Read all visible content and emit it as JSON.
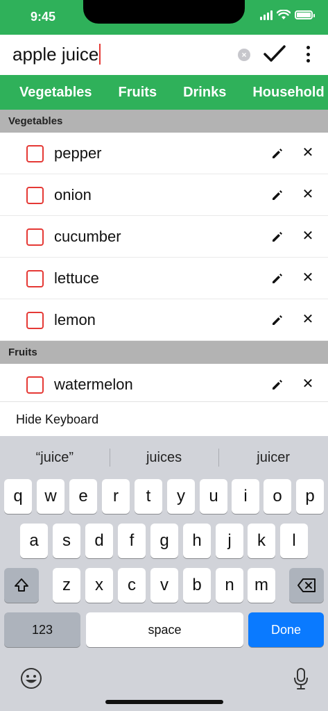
{
  "status_bar": {
    "time": "9:45"
  },
  "input": {
    "value": "apple juice"
  },
  "tabs": [
    "Vegetables",
    "Fruits",
    "Drinks",
    "Household"
  ],
  "sections": [
    {
      "title": "Vegetables",
      "items": [
        "pepper",
        "onion",
        "cucumber",
        "lettuce",
        "lemon"
      ]
    },
    {
      "title": "Fruits",
      "items": [
        "watermelon"
      ]
    }
  ],
  "hide_keyboard_label": "Hide Keyboard",
  "keyboard": {
    "suggestions": [
      "“juice”",
      "juices",
      "juicer"
    ],
    "row1": [
      "q",
      "w",
      "e",
      "r",
      "t",
      "y",
      "u",
      "i",
      "o",
      "p"
    ],
    "row2": [
      "a",
      "s",
      "d",
      "f",
      "g",
      "h",
      "j",
      "k",
      "l"
    ],
    "row3": [
      "z",
      "x",
      "c",
      "v",
      "b",
      "n",
      "m"
    ],
    "numbers_label": "123",
    "space_label": "space",
    "done_label": "Done"
  },
  "colors": {
    "brand_green": "#2fb15a",
    "checkbox_red": "#e53935",
    "done_blue": "#0a7aff"
  }
}
